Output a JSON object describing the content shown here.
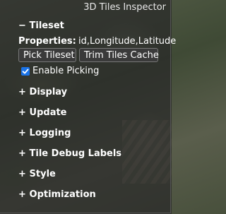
{
  "inspector": {
    "title": "3D Tiles Inspector",
    "tileset": {
      "header": "Tileset",
      "sign": "−",
      "properties_label": "Properties:",
      "properties_value": "id,Longitude,Latitude",
      "pick_button": "Pick Tileset",
      "trim_button": "Trim Tiles Cache",
      "enable_picking_label": "Enable Picking",
      "enable_picking_checked": true
    },
    "sections": [
      {
        "sign": "+",
        "label": "Display"
      },
      {
        "sign": "+",
        "label": "Update"
      },
      {
        "sign": "+",
        "label": "Logging"
      },
      {
        "sign": "+",
        "label": "Tile Debug Labels"
      },
      {
        "sign": "+",
        "label": "Style"
      },
      {
        "sign": "+",
        "label": "Optimization"
      }
    ]
  },
  "colors": {
    "checkbox": "#1a73e8",
    "panel_bg": "rgba(40,40,40,0.72)"
  }
}
